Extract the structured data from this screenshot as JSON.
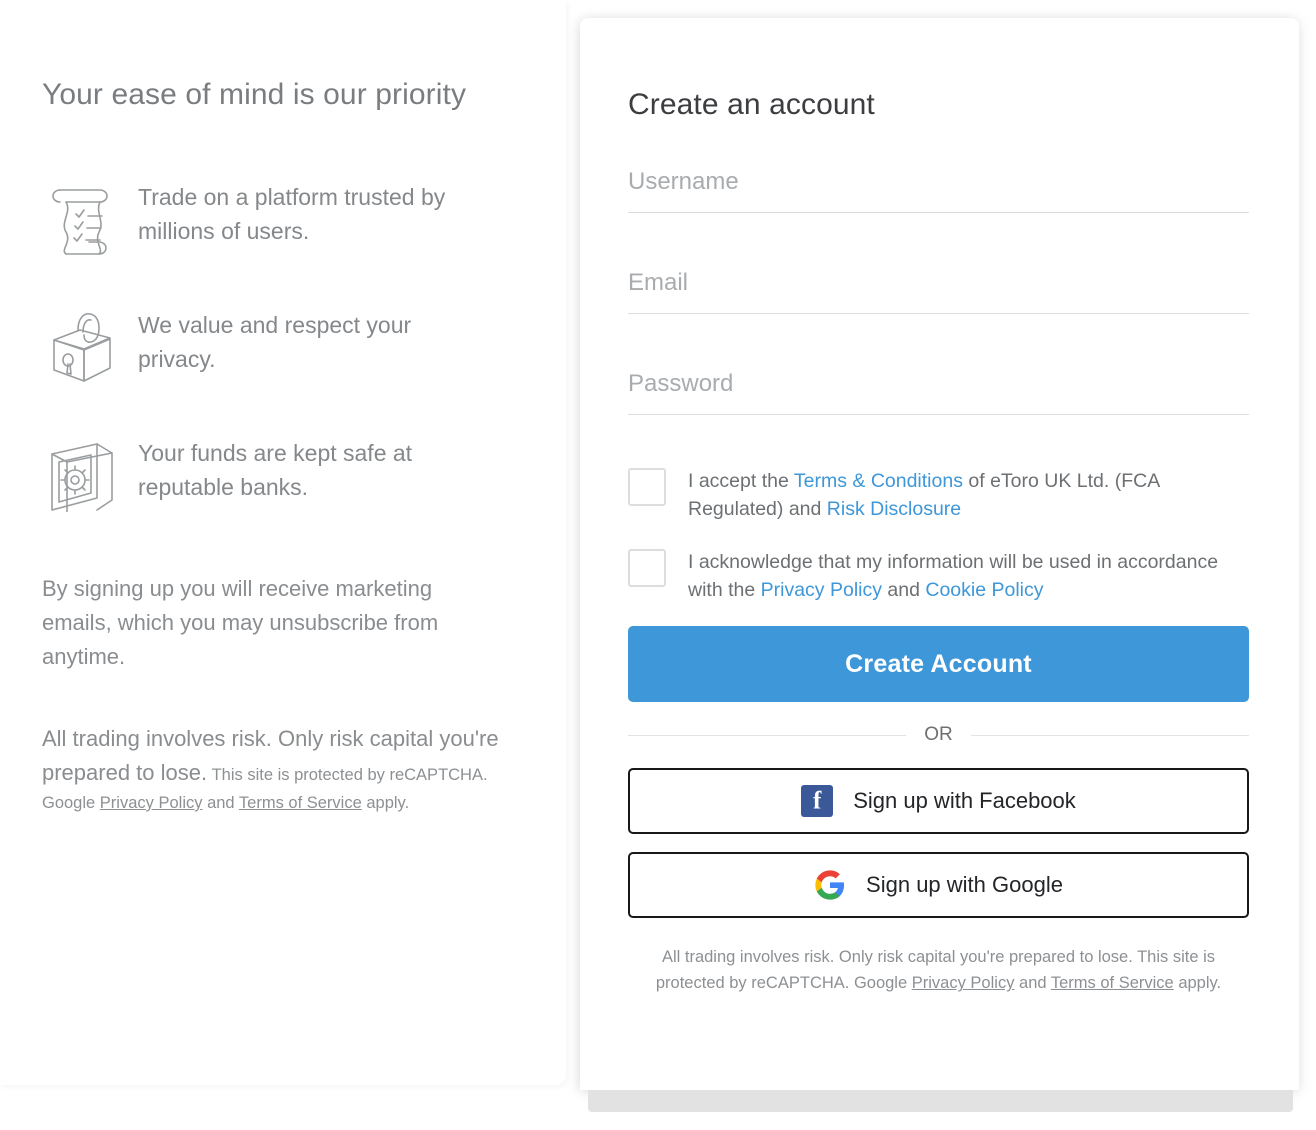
{
  "left": {
    "title": "Your ease of mind is our priority",
    "features": [
      {
        "icon": "scroll-checklist-icon",
        "text": "Trade on a platform trusted by millions of users."
      },
      {
        "icon": "padlock-icon",
        "text": "We value and respect your privacy."
      },
      {
        "icon": "safe-vault-icon",
        "text": "Your funds are kept safe at reputable banks."
      }
    ],
    "marketing_note": "By signing up you will receive marketing emails, which you may unsubscribe from anytime.",
    "risk_big": "All trading involves risk. Only risk capital you're prepared to lose.",
    "recaptcha": {
      "before": "This site is protected by reCAPTCHA. Google ",
      "privacy_policy": "Privacy Policy",
      "and": " and ",
      "terms_of_service": "Terms of Service",
      "after": " apply."
    }
  },
  "form": {
    "title": "Create an account",
    "fields": [
      {
        "name": "username",
        "placeholder": "Username",
        "value": ""
      },
      {
        "name": "email",
        "placeholder": "Email",
        "value": ""
      },
      {
        "name": "password",
        "placeholder": "Password",
        "value": ""
      }
    ],
    "consents": [
      {
        "checked": false,
        "p1": "I accept the ",
        "link1": "Terms & Conditions",
        "p2": " of eToro UK Ltd. (FCA Regulated) and ",
        "link2": "Risk Disclosure",
        "p3": ""
      },
      {
        "checked": false,
        "p1": "I acknowledge that my information will be used in accordance with the ",
        "link1": "Privacy Policy",
        "p2": " and ",
        "link2": "Cookie Policy",
        "p3": ""
      }
    ],
    "submit_label": "Create Account",
    "or_label": "OR",
    "social": [
      {
        "icon": "facebook-icon",
        "label": "Sign up with Facebook"
      },
      {
        "icon": "google-icon",
        "label": "Sign up with Google"
      }
    ],
    "footer": {
      "before": "All trading involves risk. Only risk capital you're prepared to lose. This site is protected by reCAPTCHA. Google ",
      "privacy_policy": "Privacy Policy",
      "and": " and ",
      "terms_of_service": "Terms of Service",
      "after": " apply."
    }
  },
  "colors": {
    "primary": "#3d97d9",
    "link": "#3d97d9",
    "facebook": "#3b5998",
    "text_muted": "#8a8d90",
    "card_bottom_strip": "#e2e2e2"
  }
}
